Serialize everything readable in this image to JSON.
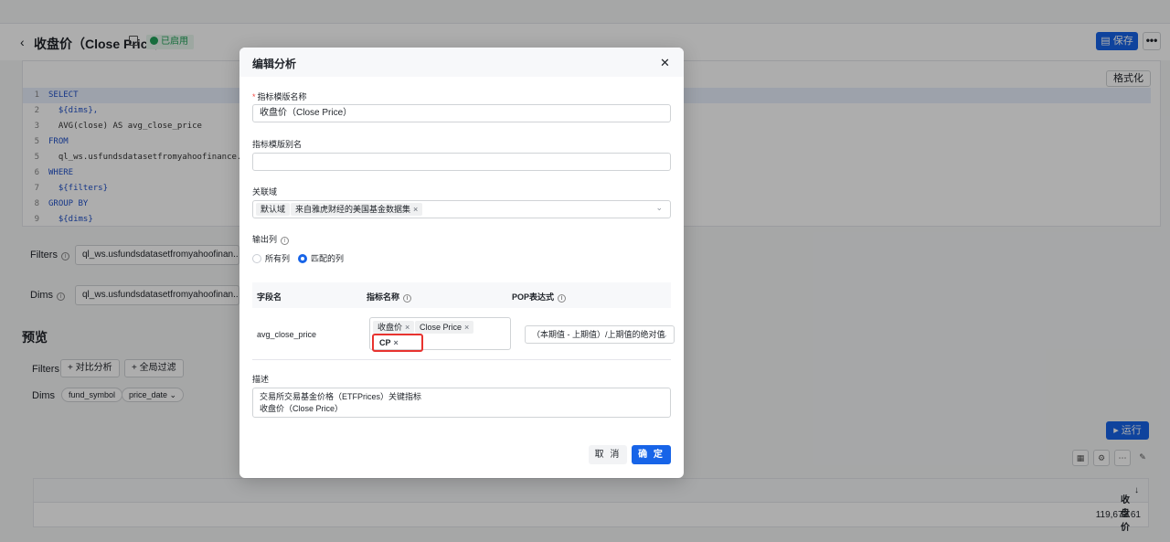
{
  "header": {
    "title": "收盘价（Close Price）",
    "status": "已启用",
    "save_label": "保存",
    "more_label": "•••"
  },
  "editor": {
    "format_label": "格式化",
    "lines": [
      {
        "n": "1",
        "text": "SELECT",
        "kw": true
      },
      {
        "n": "2",
        "text": "  ${dims},",
        "kw": true
      },
      {
        "n": "3",
        "text": "  AVG(close) AS avg_close_price",
        "kw": false
      },
      {
        "n": "5",
        "text": "FROM",
        "kw": true
      },
      {
        "n": "5",
        "text": "  ql_ws.usfundsdatasetfromyahoofinance.v_gpt_etf",
        "kw": false
      },
      {
        "n": "6",
        "text": "WHERE",
        "kw": true
      },
      {
        "n": "7",
        "text": "  ${filters}",
        "kw": true
      },
      {
        "n": "8",
        "text": "GROUP BY",
        "kw": true
      },
      {
        "n": "9",
        "text": "  ${dims}",
        "kw": true
      }
    ]
  },
  "filters": {
    "label": "Filters",
    "value": "ql_ws.usfundsdatasetfromyahoofinan..."
  },
  "dims": {
    "label": "Dims",
    "value": "ql_ws.usfundsdatasetfromyahoofinan..."
  },
  "preview": {
    "title": "预览",
    "filters_label": "Filters",
    "compare_btn": "对比分析",
    "global_filter_btn": "全局过滤",
    "dims_label": "Dims",
    "dim_tags": [
      "fund_symbol",
      "price_date"
    ],
    "run_label": "运行"
  },
  "result": {
    "column": "收盘价",
    "value": "119,672.61"
  },
  "modal": {
    "title": "编辑分析",
    "template_name_label": "指标模版名称",
    "template_name_value": "收盘价（Close Price）",
    "alias_label": "指标模版别名",
    "alias_value": "",
    "domain_label": "关联域",
    "domain_tags": [
      "默认域",
      "来自雅虎财经的美国基金数据集"
    ],
    "output_label": "输出列",
    "output_options": [
      "所有列",
      "匹配的列"
    ],
    "output_selected": "匹配的列",
    "table_headers": {
      "field": "字段名",
      "metric": "指标名称",
      "pop": "POP表达式"
    },
    "row": {
      "field": "avg_close_price",
      "metric_tags": [
        "收盘价",
        "Close Price",
        "CP"
      ],
      "pop": "（本期值 - 上期值）/上期值的绝对值"
    },
    "desc_label": "描述",
    "desc_value": "交易所交易基金价格（ETFPrices）关键指标\n收盘价（Close Price）",
    "cancel_label": "取 消",
    "ok_label": "确 定"
  }
}
